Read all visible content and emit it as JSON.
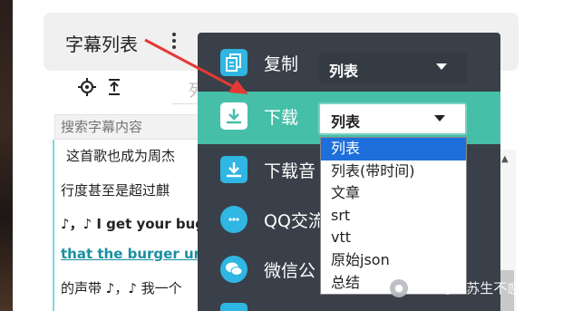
{
  "panel": {
    "title": "字幕列表",
    "tab_hint": "列",
    "search_placeholder": "搜索字幕内容",
    "subtitles": [
      "这首歌也成为周杰",
      "行度甚至是超过麒",
      "♪，♪ I get your bug",
      "that the burger und",
      "的声带 ♪，♪ 我一个"
    ]
  },
  "menu": {
    "items": [
      {
        "label": "复制",
        "icon": "copy-icon",
        "select": "列表"
      },
      {
        "label": "下载",
        "icon": "download-icon",
        "select": "列表"
      },
      {
        "label": "下载音",
        "icon": "download-icon"
      },
      {
        "label": "QQ交流",
        "icon": "chat-icon"
      },
      {
        "label": "微信公",
        "icon": "wechat-icon"
      }
    ]
  },
  "dropdown_options": [
    "列表",
    "列表(带时间)",
    "文章",
    "srt",
    "vtt",
    "原始json",
    "总结"
  ],
  "watermark": {
    "text": "公众号 · 苏生不惑"
  },
  "colors": {
    "menu_bg": "#3a4049",
    "menu_active": "#46bfa9",
    "icon_blue": "#2fb6e2",
    "option_selected": "#1e6fdc",
    "arrow": "#e53935"
  }
}
